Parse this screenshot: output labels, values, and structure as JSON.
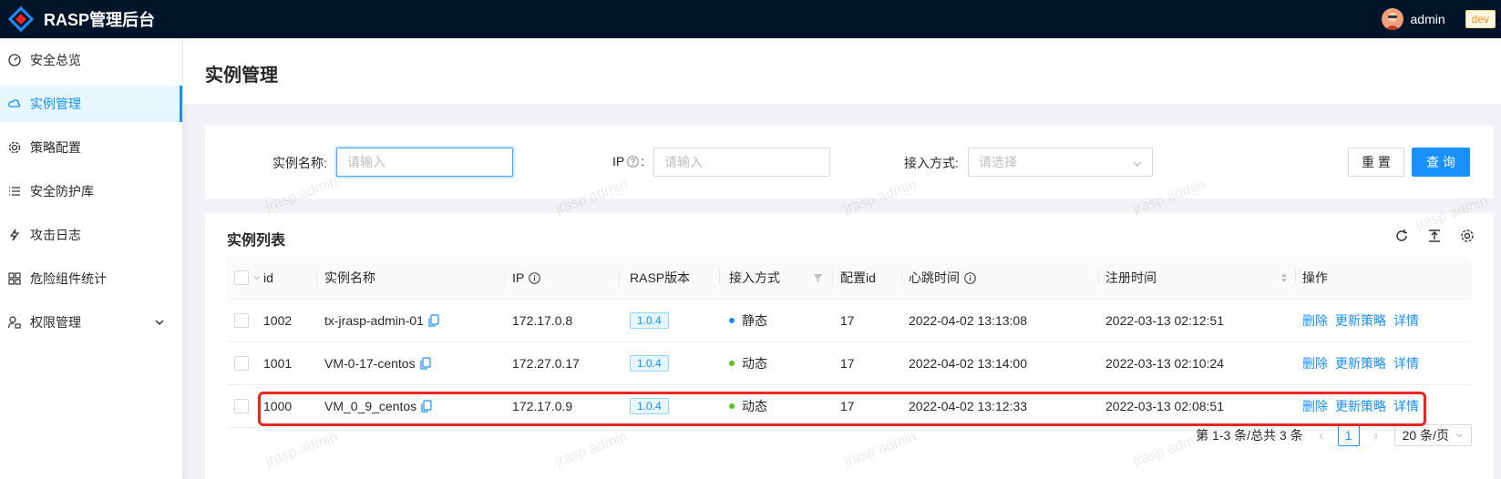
{
  "app": {
    "title": "RASP管理后台",
    "user": "admin",
    "env": "dev"
  },
  "sidebar": {
    "items": [
      {
        "label": "安全总览",
        "icon": "dashboard-icon"
      },
      {
        "label": "实例管理",
        "icon": "cloud-icon",
        "active": true
      },
      {
        "label": "策略配置",
        "icon": "gear-icon"
      },
      {
        "label": "安全防护库",
        "icon": "list-icon"
      },
      {
        "label": "攻击日志",
        "icon": "thunderbolt-icon"
      },
      {
        "label": "危险组件统计",
        "icon": "appstore-icon"
      },
      {
        "label": "权限管理",
        "icon": "user-lock-icon",
        "expandable": true
      }
    ]
  },
  "page": {
    "title": "实例管理"
  },
  "search": {
    "name_label": "实例名称:",
    "name_placeholder": "请输入",
    "ip_label": "IP",
    "ip_colon": ":",
    "ip_placeholder": "请输入",
    "access_label": "接入方式:",
    "access_placeholder": "请选择",
    "reset": "重 置",
    "query": "查 询"
  },
  "table": {
    "title": "实例列表",
    "columns": {
      "id": "id",
      "name": "实例名称",
      "ip": "IP",
      "rasp_version": "RASP版本",
      "access_mode": "接入方式",
      "config_id": "配置id",
      "heartbeat": "心跳时间",
      "register": "注册时间",
      "actions": "操作"
    },
    "rows": [
      {
        "id": "1002",
        "name": "tx-jrasp-admin-01",
        "ip": "172.17.0.8",
        "version": "1.0.4",
        "mode": "静态",
        "config_id": "17",
        "heartbeat": "2022-04-02 13:13:08",
        "register": "2022-03-13 02:12:51"
      },
      {
        "id": "1001",
        "name": "VM-0-17-centos",
        "ip": "172.27.0.17",
        "version": "1.0.4",
        "mode": "动态",
        "config_id": "17",
        "heartbeat": "2022-04-02 13:14:00",
        "register": "2022-03-13 02:10:24"
      },
      {
        "id": "1000",
        "name": "VM_0_9_centos",
        "ip": "172.17.0.9",
        "version": "1.0.4",
        "mode": "动态",
        "config_id": "17",
        "heartbeat": "2022-04-02 13:12:33",
        "register": "2022-03-13 02:08:51"
      }
    ],
    "actions": {
      "delete": "删除",
      "update": "更新策略",
      "detail": "详情"
    },
    "mode_colors": {
      "静态": "#1890ff",
      "动态": "#52c41a"
    }
  },
  "pagination": {
    "summary": "第 1-3 条/总共 3 条",
    "current": "1",
    "page_size": "20 条/页"
  },
  "watermark": "jrasp admin",
  "colors": {
    "primary": "#1890ff",
    "topbar": "#001529",
    "highlight": "#e8251f"
  }
}
